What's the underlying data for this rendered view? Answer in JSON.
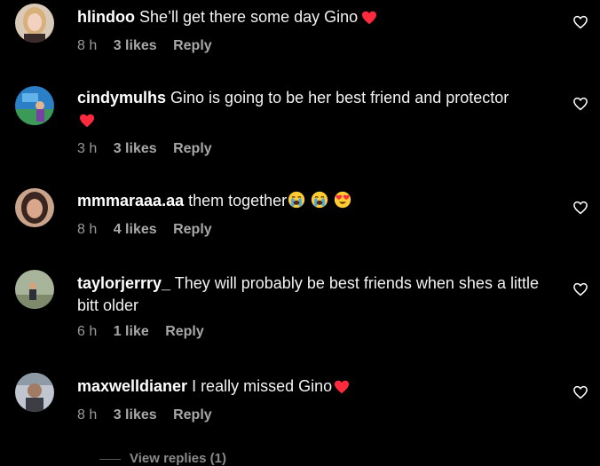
{
  "comments": [
    {
      "username": "hlindoo",
      "text": " She’ll get there some day Gino",
      "time": "8 h",
      "likes": "3 likes",
      "reply": "Reply",
      "emojis": [
        "red-heart"
      ]
    },
    {
      "username": "cindymulhs",
      "text": " Gino is going to be her best friend and protector",
      "time": "3 h",
      "likes": "3 likes",
      "reply": "Reply",
      "emojis": [
        "red-heart"
      ]
    },
    {
      "username": "mmmaraaa.aa",
      "text": " them together",
      "time": "8 h",
      "likes": "4 likes",
      "reply": "Reply",
      "emojis": [
        "crying-face",
        "crying-face",
        "heart-eyes-face"
      ]
    },
    {
      "username": "taylorjerrry_",
      "text": " They will probably be best friends when shes a little bitt older",
      "time": "6 h",
      "likes": "1 like",
      "reply": "Reply",
      "emojis": []
    },
    {
      "username": "maxwelldianer",
      "text": " I really missed Gino",
      "time": "8 h",
      "likes": "3 likes",
      "reply": "Reply",
      "emojis": [
        "red-heart"
      ]
    }
  ],
  "view_replies": "View replies (1)",
  "colors": {
    "background": "#000000",
    "text": "#f2f2f2",
    "meta": "#9a9a9a",
    "heart": "#ff2a3d"
  }
}
